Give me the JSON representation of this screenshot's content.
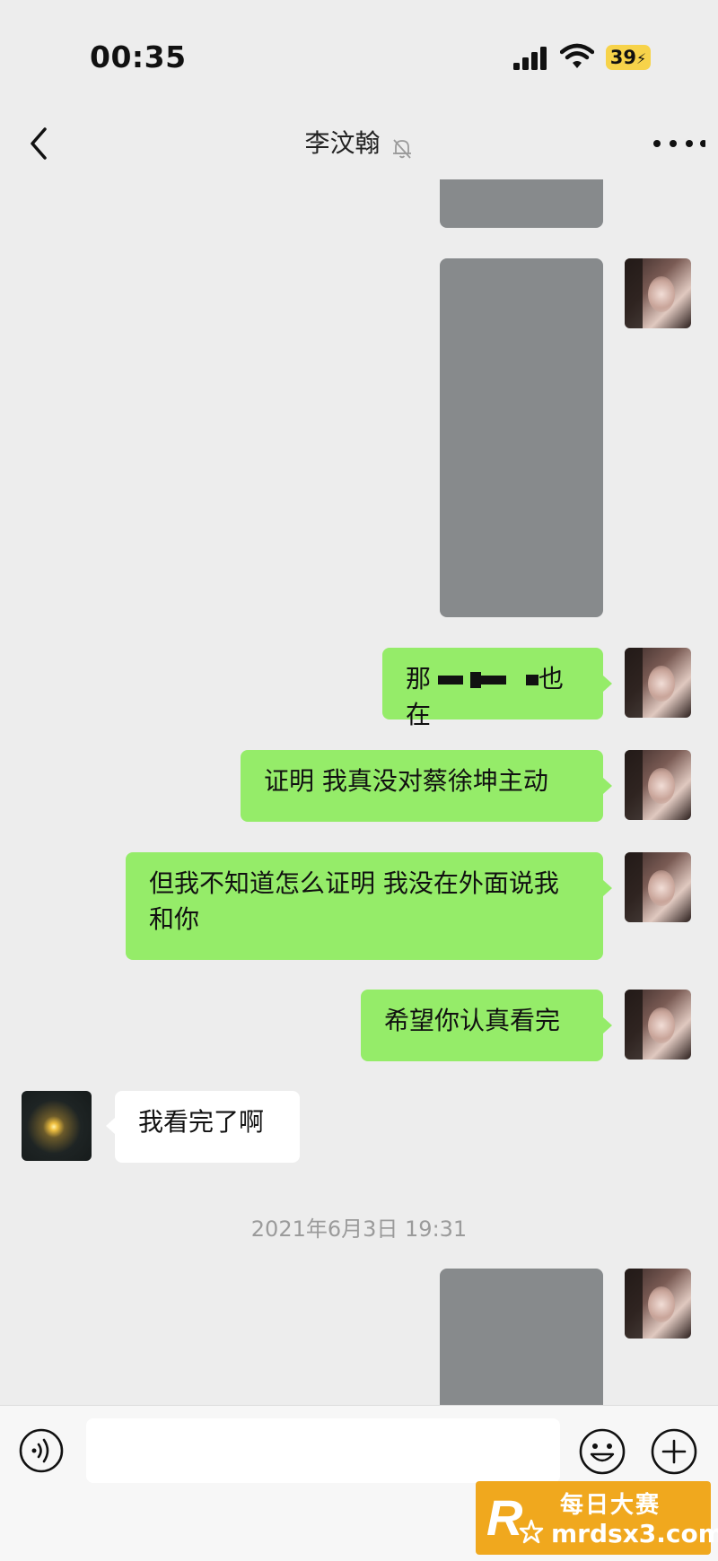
{
  "status_bar": {
    "time": "00:35",
    "battery_level": "39",
    "battery_color": "#f7d34a"
  },
  "nav": {
    "title": "李汶翰",
    "back_icon": "chevron-left-icon",
    "mute_icon": "bell-off-icon",
    "more_icon": "more-dots-icon"
  },
  "messages": {
    "m3": {
      "text_a": "那",
      "text_b": "也在"
    },
    "m4": {
      "text": "证明 我真没对蔡徐坤主动"
    },
    "m5": {
      "text": "但我不知道怎么证明 我没在外面说我和你"
    },
    "m6": {
      "text": "希望你认真看完"
    },
    "m7": {
      "text": "我看完了啊"
    },
    "separator": "2021年6月3日 19:31"
  },
  "input_bar": {
    "text_value": "",
    "voice_icon": "voice-icon",
    "emoji_icon": "emoji-icon",
    "plus_icon": "plus-icon"
  },
  "watermark": {
    "title": "每日大赛",
    "url": "mrdsx3.com"
  },
  "colors": {
    "background": "#ededed",
    "my_bubble": "#95ec69",
    "other_bubble": "#ffffff",
    "image_placeholder": "#878a8c"
  }
}
